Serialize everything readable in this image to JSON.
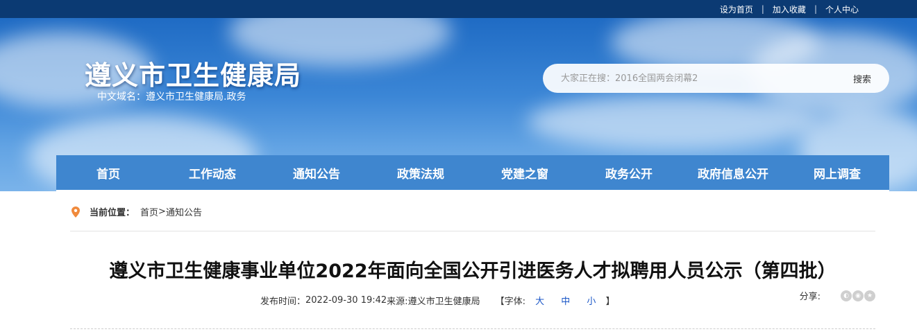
{
  "topbar": {
    "links": [
      "设为首页",
      "加入收藏",
      "个人中心"
    ],
    "separator": "|"
  },
  "header": {
    "title": "遵义市卫生健康局",
    "domain": "中文域名：遵义市卫生健康局.政务"
  },
  "search": {
    "placeholder": "大家正在搜：2016全国两会闭幕2",
    "button_label": "搜索"
  },
  "nav": {
    "items": [
      "首页",
      "工作动态",
      "通知公告",
      "政策法规",
      "党建之窗",
      "政务公开",
      "政府信息公开",
      "网上调查"
    ]
  },
  "breadcrumb": {
    "label": "当前位置：",
    "home": "首页",
    "sep": ">",
    "current": "通知公告"
  },
  "article": {
    "title": "遵义市卫生健康事业单位2022年面向全国公开引进医务人才拟聘用人员公示（第四批）",
    "published_label": "发布时间：",
    "published": "2022-09-30 19:42",
    "source_label": "来源:",
    "source": "遵义市卫生健康局",
    "fontsize_open": "【字体:",
    "fontsize_large": "大",
    "fontsize_medium": "中",
    "fontsize_small": "小",
    "fontsize_close": "】",
    "share_label": "分享:"
  },
  "colors": {
    "topbar": "#0b3a73",
    "nav": "#3f86cf",
    "link_blue": "#1a56c7",
    "pin": "#f08a3c"
  }
}
